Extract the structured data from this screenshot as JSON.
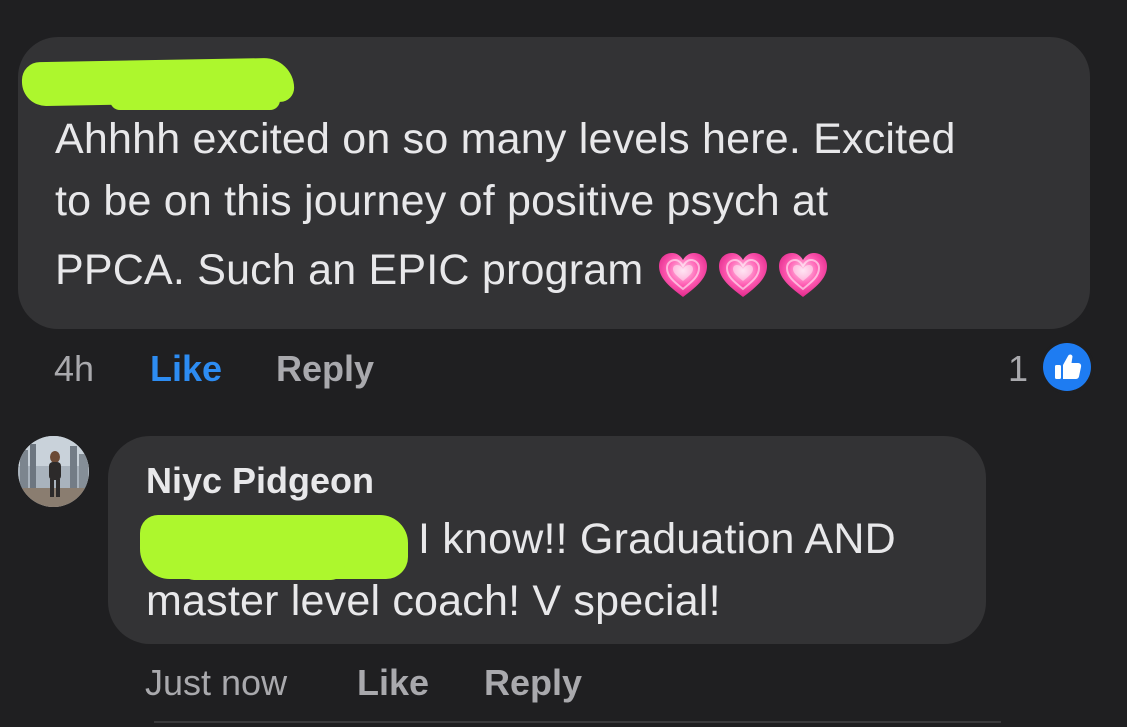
{
  "comments": [
    {
      "author_name_visible": "",
      "text_lines": [
        "Ahhhh excited on so many levels here. Excited",
        "to be on this journey of positive psych at",
        "PPCA. Such an EPIC program"
      ],
      "emoji": [
        "growing-heart-emoji",
        "growing-heart-emoji",
        "growing-heart-emoji"
      ],
      "actions": {
        "time": "4h",
        "like": "Like",
        "reply": "Reply"
      },
      "reaction_count": "1",
      "reaction_icon": "like-thumb-icon",
      "like_color": "#2d8cf2"
    },
    {
      "author_name": "Niyc Pidgeon",
      "text_lines": [
        "I know!! Graduation AND",
        "master level coach! V special!"
      ],
      "actions": {
        "time": "Just now",
        "like": "Like",
        "reply": "Reply"
      }
    }
  ],
  "colors": {
    "background": "#1f1f21",
    "bubble": "#333335",
    "text": "#e8e8ea",
    "muted": "#a9a9ad",
    "redaction": "#b4f24a",
    "like_badge": "#1e7cf2"
  }
}
